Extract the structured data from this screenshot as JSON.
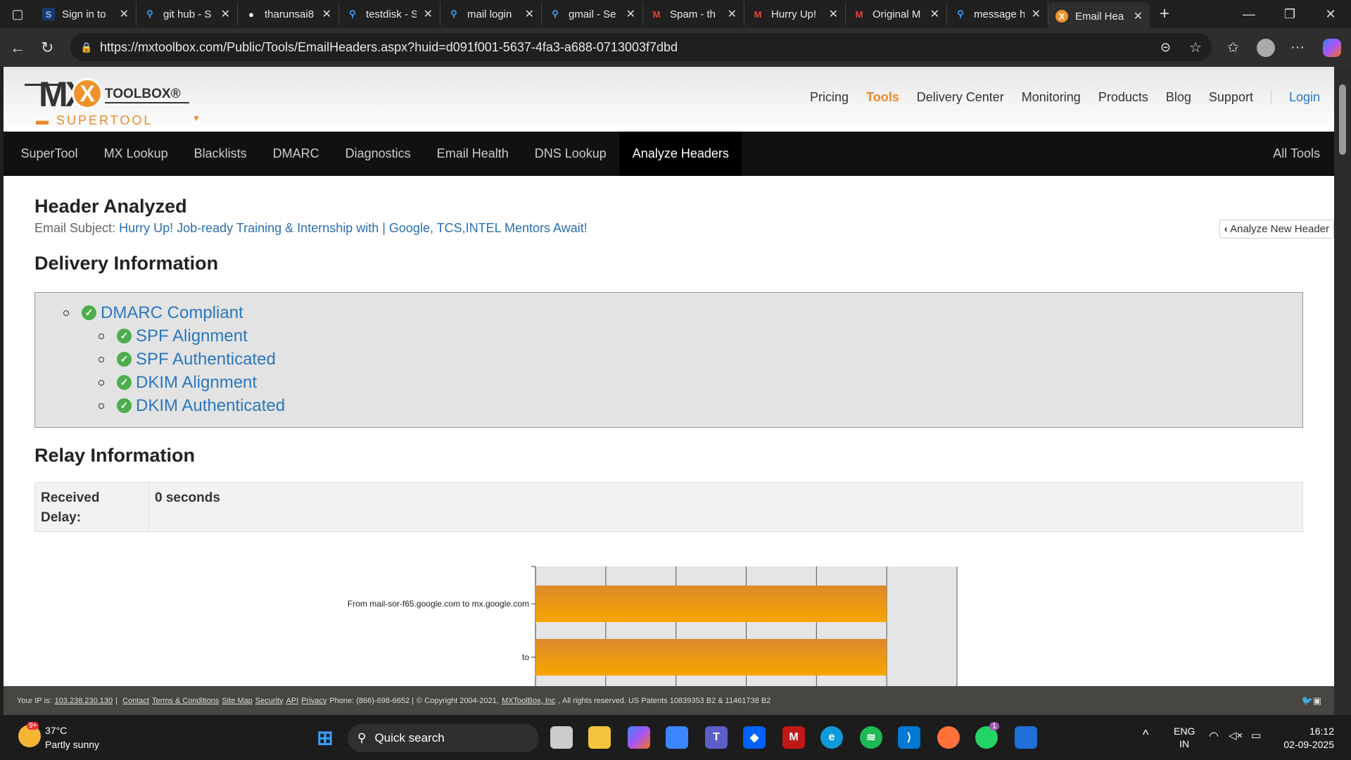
{
  "browser": {
    "tabs": [
      {
        "label": "Sign in to",
        "icon": "s-icon"
      },
      {
        "label": "git hub - S",
        "icon": "search-icon"
      },
      {
        "label": "tharunsai8",
        "icon": "github-icon"
      },
      {
        "label": "testdisk - S",
        "icon": "search-icon"
      },
      {
        "label": "mail login",
        "icon": "search-icon"
      },
      {
        "label": "gmail - Se",
        "icon": "search-icon"
      },
      {
        "label": "Spam - th",
        "icon": "gmail-icon"
      },
      {
        "label": "Hurry Up!",
        "icon": "gmail-icon"
      },
      {
        "label": "Original M",
        "icon": "gmail-icon"
      },
      {
        "label": "message h",
        "icon": "search-icon"
      },
      {
        "label": "Email Hea",
        "icon": "mxtoolbox-icon"
      }
    ],
    "url": "https://mxtoolbox.com/Public/Tools/EmailHeaders.aspx?huid=d091f001-5637-4fa3-a688-0713003f7dbd"
  },
  "logo": {
    "brand": "TOOLBOX®",
    "mx": "MX",
    "product": "SUPERTOOL"
  },
  "main_nav": [
    "Pricing",
    "Tools",
    "Delivery Center",
    "Monitoring",
    "Products",
    "Blog",
    "Support"
  ],
  "login": "Login",
  "sub_nav": [
    "SuperTool",
    "MX Lookup",
    "Blacklists",
    "DMARC",
    "Diagnostics",
    "Email Health",
    "DNS Lookup",
    "Analyze Headers"
  ],
  "all_tools": "All Tools",
  "content": {
    "title": "Header Analyzed",
    "subject_label": "Email Subject:",
    "subject": "Hurry Up! Job-ready Training & Internship with | Google, TCS,INTEL Mentors Await!",
    "new_header_btn": "Analyze New Header",
    "delivery_title": "Delivery Information",
    "dmarc": "DMARC Compliant",
    "checks": [
      "SPF Alignment",
      "SPF Authenticated",
      "DKIM Alignment",
      "DKIM Authenticated"
    ],
    "relay_title": "Relay Information",
    "relay_key": "Received Delay:",
    "relay_value": "0 seconds"
  },
  "chart_data": {
    "type": "bar",
    "orientation": "horizontal",
    "categories": [
      "From mail-sor-f65.google.com to mx.google.com",
      "to"
    ],
    "values": [
      5,
      5
    ],
    "xlim": [
      0,
      6
    ],
    "grid": true,
    "colors": [
      "#dc8a2c",
      "#f8a500"
    ]
  },
  "footer": {
    "ip_label": "Your IP is:",
    "ip": "103.238.230.130",
    "links": [
      "Contact",
      "Terms & Conditions",
      "Site Map",
      "Security",
      "API",
      "Privacy"
    ],
    "phone": "Phone: (866)-698-6652 |",
    "copyright": "© Copyright 2004-2021,",
    "company": "MXToolBox, Inc",
    "rights": ", All rights reserved. US Patents 10839353 B2 & 11461738 B2"
  },
  "taskbar": {
    "temp": "37°C",
    "weather": "Partly sunny",
    "weather_badge": "9+",
    "search": "Quick search",
    "lang1": "ENG",
    "lang2": "IN",
    "time": "16:12",
    "date": "02-09-2025",
    "whatsapp_badge": "1"
  }
}
